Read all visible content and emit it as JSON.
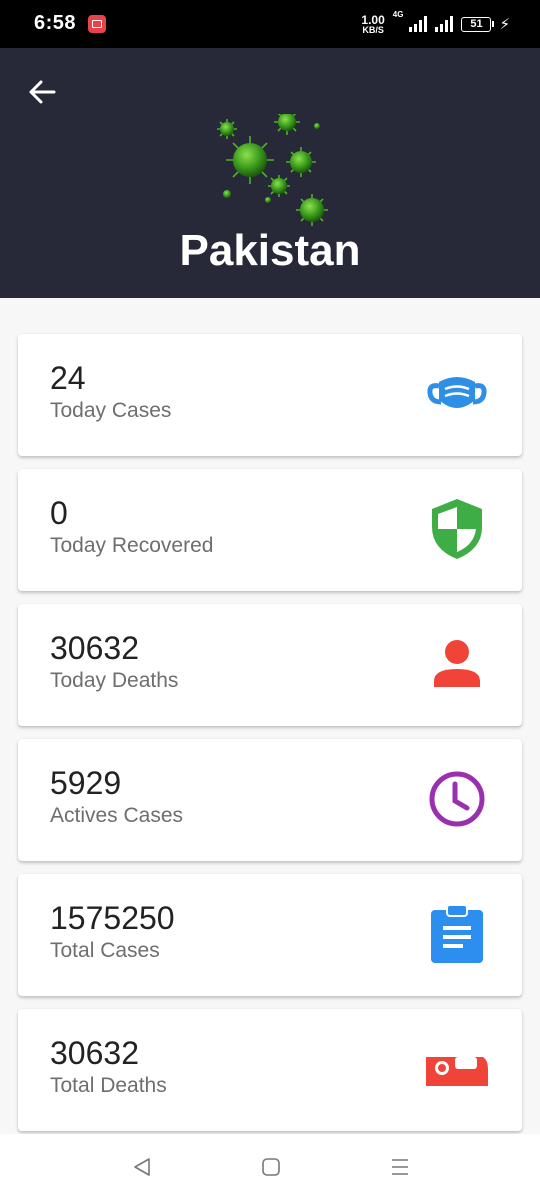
{
  "status_bar": {
    "time": "6:58",
    "net_speed_value": "1.00",
    "net_speed_unit": "KB/S",
    "network_type": "4G",
    "battery": "51"
  },
  "header": {
    "country": "Pakistan"
  },
  "stats": [
    {
      "value": "24",
      "label": "Today Cases",
      "icon": "mask-icon",
      "color": "#2f8fe6"
    },
    {
      "value": "0",
      "label": "Today Recovered",
      "icon": "shield-icon",
      "color": "#3fad46"
    },
    {
      "value": "30632",
      "label": "Today Deaths",
      "icon": "person-icon",
      "color": "#f04438"
    },
    {
      "value": "5929",
      "label": "Actives Cases",
      "icon": "clock-icon",
      "color": "#9a2fb0"
    },
    {
      "value": "1575250",
      "label": "Total Cases",
      "icon": "clipboard-icon",
      "color": "#2c8ff0"
    },
    {
      "value": "30632",
      "label": "Total Deaths",
      "icon": "bed-icon",
      "color": "#f04438"
    }
  ],
  "nav": [
    "back",
    "home",
    "menu"
  ]
}
